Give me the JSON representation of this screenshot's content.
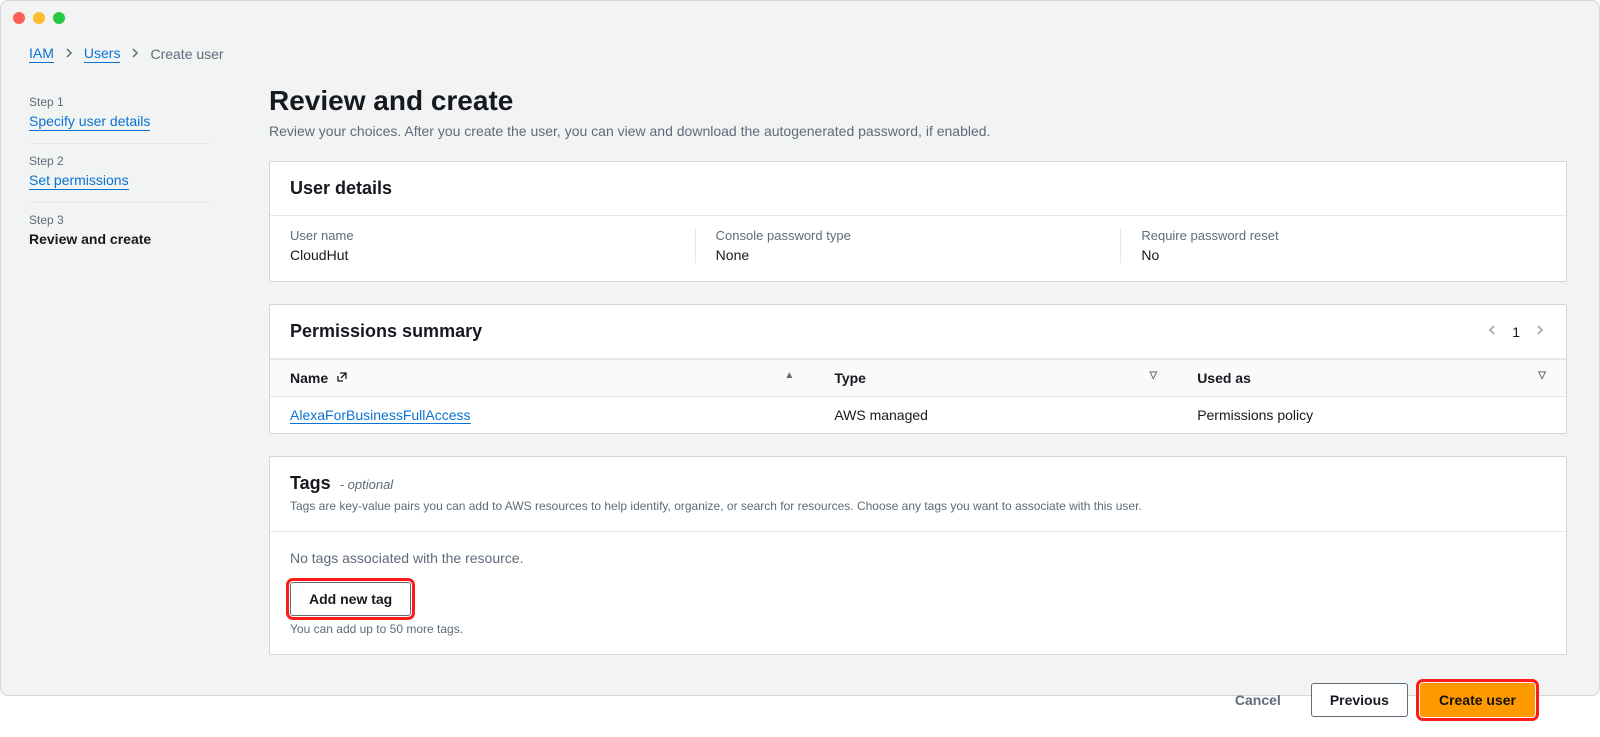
{
  "breadcrumb": {
    "items": [
      "IAM",
      "Users"
    ],
    "current": "Create user"
  },
  "steps": [
    {
      "label": "Step 1",
      "title": "Specify user details",
      "link": true
    },
    {
      "label": "Step 2",
      "title": "Set permissions",
      "link": true
    },
    {
      "label": "Step 3",
      "title": "Review and create",
      "link": false
    }
  ],
  "page": {
    "title": "Review and create",
    "subtitle": "Review your choices. After you create the user, you can view and download the autogenerated password, if enabled."
  },
  "user_details": {
    "panel_title": "User details",
    "columns": [
      {
        "label": "User name",
        "value": "CloudHut"
      },
      {
        "label": "Console password type",
        "value": "None"
      },
      {
        "label": "Require password reset",
        "value": "No"
      }
    ]
  },
  "permissions": {
    "panel_title": "Permissions summary",
    "page_number": "1",
    "columns": {
      "name": "Name",
      "type": "Type",
      "used_as": "Used as"
    },
    "rows": [
      {
        "name": "AlexaForBusinessFullAccess",
        "type": "AWS managed",
        "used_as": "Permissions policy"
      }
    ]
  },
  "tags": {
    "panel_title": "Tags",
    "optional_label": "- optional",
    "panel_desc": "Tags are key-value pairs you can add to AWS resources to help identify, organize, or search for resources. Choose any tags you want to associate with this user.",
    "empty_text": "No tags associated with the resource.",
    "add_button": "Add new tag",
    "hint": "You can add up to 50 more tags."
  },
  "footer": {
    "cancel": "Cancel",
    "previous": "Previous",
    "create": "Create user"
  }
}
